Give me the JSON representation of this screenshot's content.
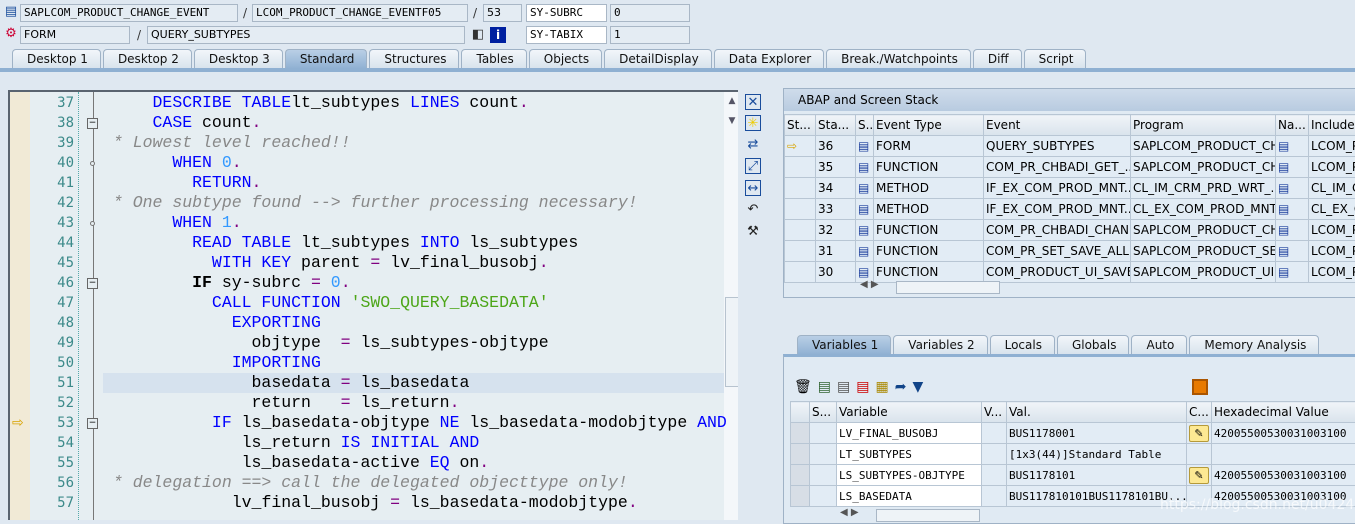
{
  "header": {
    "program": "SAPLCOM_PRODUCT_CHANGE_EVENT",
    "include": "LCOM_PRODUCT_CHANGE_EVENTF05",
    "line": "53",
    "event_type": "FORM",
    "event": "QUERY_SUBTYPES",
    "sys1_name": "SY-SUBRC",
    "sys1_value": "0",
    "sys2_name": "SY-TABIX",
    "sys2_value": "1",
    "sep": "/"
  },
  "tabs": [
    "Desktop 1",
    "Desktop 2",
    "Desktop 3",
    "Standard",
    "Structures",
    "Tables",
    "Objects",
    "DetailDisplay",
    "Data Explorer",
    "Break./Watchpoints",
    "Diff",
    "Script"
  ],
  "active_tab": "Standard",
  "code": [
    {
      "n": "37",
      "ind": 4,
      "t": [
        [
          "kw",
          "DESCRIBE TABLE"
        ],
        [
          "",
          "lt_subtypes "
        ],
        [
          "kw",
          "LINES"
        ],
        [
          "",
          " count"
        ],
        [
          "op",
          "."
        ]
      ]
    },
    {
      "n": "38",
      "ind": 4,
      "fold": true,
      "t": [
        [
          "kw",
          "CASE"
        ],
        [
          "",
          " count"
        ],
        [
          "op",
          "."
        ]
      ]
    },
    {
      "n": "39",
      "ind": 0,
      "t": [
        [
          "com",
          "* Lowest level reached!!"
        ]
      ]
    },
    {
      "n": "40",
      "ind": 6,
      "knot": true,
      "t": [
        [
          "kw",
          "WHEN"
        ],
        [
          "",
          " "
        ],
        [
          "num",
          "0"
        ],
        [
          "op",
          "."
        ]
      ]
    },
    {
      "n": "41",
      "ind": 8,
      "t": [
        [
          "kw",
          "RETURN"
        ],
        [
          "op",
          "."
        ]
      ]
    },
    {
      "n": "42",
      "ind": 0,
      "t": [
        [
          "com",
          "* One subtype found --> further processing necessary!"
        ]
      ]
    },
    {
      "n": "43",
      "ind": 6,
      "knot": true,
      "t": [
        [
          "kw",
          "WHEN"
        ],
        [
          "",
          " "
        ],
        [
          "num",
          "1"
        ],
        [
          "op",
          "."
        ]
      ]
    },
    {
      "n": "44",
      "ind": 8,
      "t": [
        [
          "kw",
          "READ TABLE"
        ],
        [
          "",
          " lt_subtypes "
        ],
        [
          "kw",
          "INTO"
        ],
        [
          "",
          " ls_subtypes"
        ]
      ]
    },
    {
      "n": "45",
      "ind": 10,
      "t": [
        [
          "kw",
          "WITH KEY"
        ],
        [
          "",
          " parent "
        ],
        [
          "op",
          "="
        ],
        [
          "",
          " lv_final_busobj"
        ],
        [
          "op",
          "."
        ]
      ]
    },
    {
      "n": "46",
      "ind": 8,
      "fold": true,
      "t": [
        [
          "bold",
          "IF"
        ],
        [
          "",
          " sy-subrc "
        ],
        [
          "op",
          "="
        ],
        [
          "",
          " "
        ],
        [
          "num",
          "0"
        ],
        [
          "op",
          "."
        ]
      ]
    },
    {
      "n": "47",
      "ind": 10,
      "t": [
        [
          "kw",
          "CALL FUNCTION"
        ],
        [
          "",
          " "
        ],
        [
          "str",
          "'SWO_QUERY_BASEDATA'"
        ]
      ]
    },
    {
      "n": "48",
      "ind": 12,
      "t": [
        [
          "kw",
          "EXPORTING"
        ]
      ]
    },
    {
      "n": "49",
      "ind": 14,
      "t": [
        [
          "",
          "objtype  "
        ],
        [
          "op",
          "="
        ],
        [
          "",
          " ls_subtypes-objtype"
        ]
      ]
    },
    {
      "n": "50",
      "ind": 12,
      "t": [
        [
          "kw",
          "IMPORTING"
        ]
      ]
    },
    {
      "n": "51",
      "ind": 14,
      "hl": true,
      "t": [
        [
          "",
          "basedata "
        ],
        [
          "op",
          "="
        ],
        [
          "",
          " ls_basedata"
        ]
      ]
    },
    {
      "n": "52",
      "ind": 14,
      "t": [
        [
          "",
          "return   "
        ],
        [
          "op",
          "="
        ],
        [
          "",
          " ls_return"
        ],
        [
          "op",
          "."
        ]
      ]
    },
    {
      "n": "53",
      "ind": 10,
      "fold": true,
      "current": true,
      "t": [
        [
          "kw",
          "IF"
        ],
        [
          "",
          " ls_basedata-objtype "
        ],
        [
          "kw",
          "NE"
        ],
        [
          "",
          " ls_basedata-modobjtype "
        ],
        [
          "kw",
          "AND"
        ]
      ]
    },
    {
      "n": "54",
      "ind": 13,
      "t": [
        [
          "",
          "ls_return "
        ],
        [
          "kw",
          "IS INITIAL AND"
        ]
      ]
    },
    {
      "n": "55",
      "ind": 13,
      "t": [
        [
          "",
          "ls_basedata-active "
        ],
        [
          "kw",
          "EQ"
        ],
        [
          "",
          " on"
        ],
        [
          "op",
          "."
        ]
      ]
    },
    {
      "n": "56",
      "ind": 0,
      "t": [
        [
          "com",
          "* delegation ==> call the delegated objecttype only!"
        ]
      ]
    },
    {
      "n": "57",
      "ind": 12,
      "t": [
        [
          "",
          "lv_final_busobj "
        ],
        [
          "op",
          "="
        ],
        [
          "",
          " ls_basedata-modobjtype"
        ],
        [
          "op",
          "."
        ]
      ]
    }
  ],
  "stack": {
    "title": "ABAP and Screen Stack",
    "columns": [
      "St...",
      "Sta...",
      "S..",
      "Event Type",
      "Event",
      "Program",
      "Na...",
      "Include"
    ],
    "rows": [
      {
        "level": "36",
        "type": "FORM",
        "event": "QUERY_SUBTYPES",
        "program": "SAPLCOM_PRODUCT_CH...",
        "include": "LCOM_PI",
        "current": true
      },
      {
        "level": "35",
        "type": "FUNCTION",
        "event": "COM_PR_CHBADI_GET_...",
        "program": "SAPLCOM_PRODUCT_CH...",
        "include": "LCOM_PI"
      },
      {
        "level": "34",
        "type": "METHOD",
        "event": "IF_EX_COM_PROD_MNT...",
        "program": "CL_IM_CRM_PRD_WRT_...",
        "include": "CL_IM_C"
      },
      {
        "level": "33",
        "type": "METHOD",
        "event": "IF_EX_COM_PROD_MNT...",
        "program": "CL_EX_COM_PROD_MNT...",
        "include": "CL_EX_C"
      },
      {
        "level": "32",
        "type": "FUNCTION",
        "event": "COM_PR_CHBADI_CHAN...",
        "program": "SAPLCOM_PRODUCT_CH...",
        "include": "LCOM_PI"
      },
      {
        "level": "31",
        "type": "FUNCTION",
        "event": "COM_PR_SET_SAVE_ALL",
        "program": "SAPLCOM_PRODUCT_SET",
        "include": "LCOM_PI"
      },
      {
        "level": "30",
        "type": "FUNCTION",
        "event": "COM_PRODUCT_UI_SAVE",
        "program": "SAPLCOM_PRODUCT_UI...",
        "include": "LCOM_PI"
      }
    ]
  },
  "var_tabs": [
    "Variables 1",
    "Variables 2",
    "Locals",
    "Globals",
    "Auto",
    "Memory Analysis"
  ],
  "vars": {
    "columns": [
      "S...",
      "Variable",
      "V...",
      "Val.",
      "C...",
      "Hexadecimal Value"
    ],
    "rows": [
      {
        "name": "LV_FINAL_BUSOBJ",
        "val": "BUS1178001",
        "hex": "42005500530031003100",
        "edit": true
      },
      {
        "name": "LT_SUBTYPES",
        "val": "[1x3(44)]Standard Table",
        "hex": "",
        "edit": false
      },
      {
        "name": "LS_SUBTYPES-OBJTYPE",
        "val": "BUS1178101",
        "hex": "42005500530031003100",
        "edit": true
      },
      {
        "name": "LS_BASEDATA",
        "val": "BUS117810101BUS1178101BU...",
        "hex": "42005500530031003100",
        "edit": false
      }
    ]
  },
  "watermark": "https://blog.csdn.net/u042416",
  "colors": {
    "keyword": "#0000ff",
    "number": "#3399ff",
    "string": "#4da619",
    "comment": "#888888",
    "operator": "#800080",
    "accent": "#8fb0d2"
  }
}
